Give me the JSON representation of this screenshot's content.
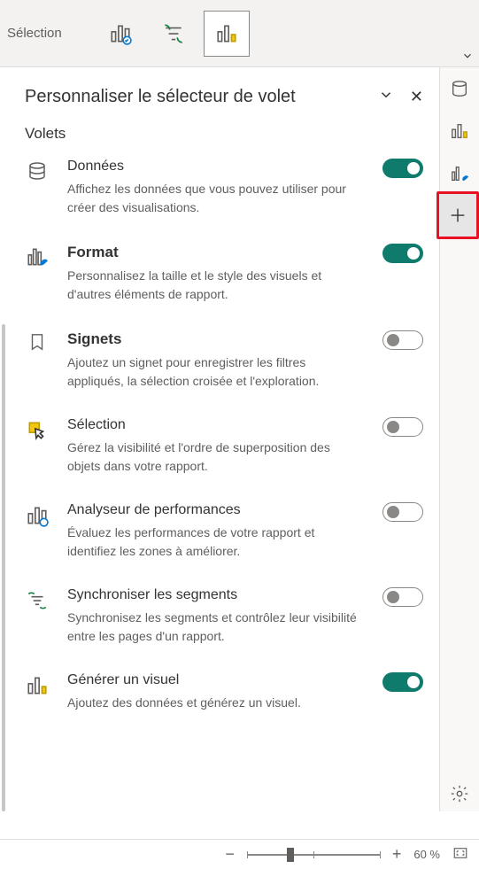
{
  "topbar": {
    "label": "Sélection"
  },
  "panel": {
    "title": "Personnaliser le sélecteur de volet",
    "section": "Volets"
  },
  "panes": {
    "data": {
      "name": "Données",
      "desc": "Affichez les données que vous pouvez utiliser pour créer des visualisations."
    },
    "format": {
      "name": "Format",
      "desc": "Personnalisez la taille et le style des visuels et d'autres éléments de rapport."
    },
    "bookmarks": {
      "name": "Signets",
      "desc": "Ajoutez un signet pour enregistrer les filtres appliqués, la sélection croisée et l'exploration."
    },
    "selection": {
      "name": "Sélection",
      "desc": "Gérez la visibilité et l'ordre de superposition des objets dans votre rapport."
    },
    "perf": {
      "name": "Analyseur de performances",
      "desc": "Évaluez les performances de votre rapport et identifiez les zones à améliorer."
    },
    "sync": {
      "name": "Synchroniser les segments",
      "desc": "Synchronisez les segments et contrôlez leur visibilité entre les pages d'un rapport."
    },
    "genvisual": {
      "name": "Générer un visuel",
      "desc": "Ajoutez des données et générez un visuel."
    }
  },
  "zoom": {
    "percent": "60 %"
  }
}
